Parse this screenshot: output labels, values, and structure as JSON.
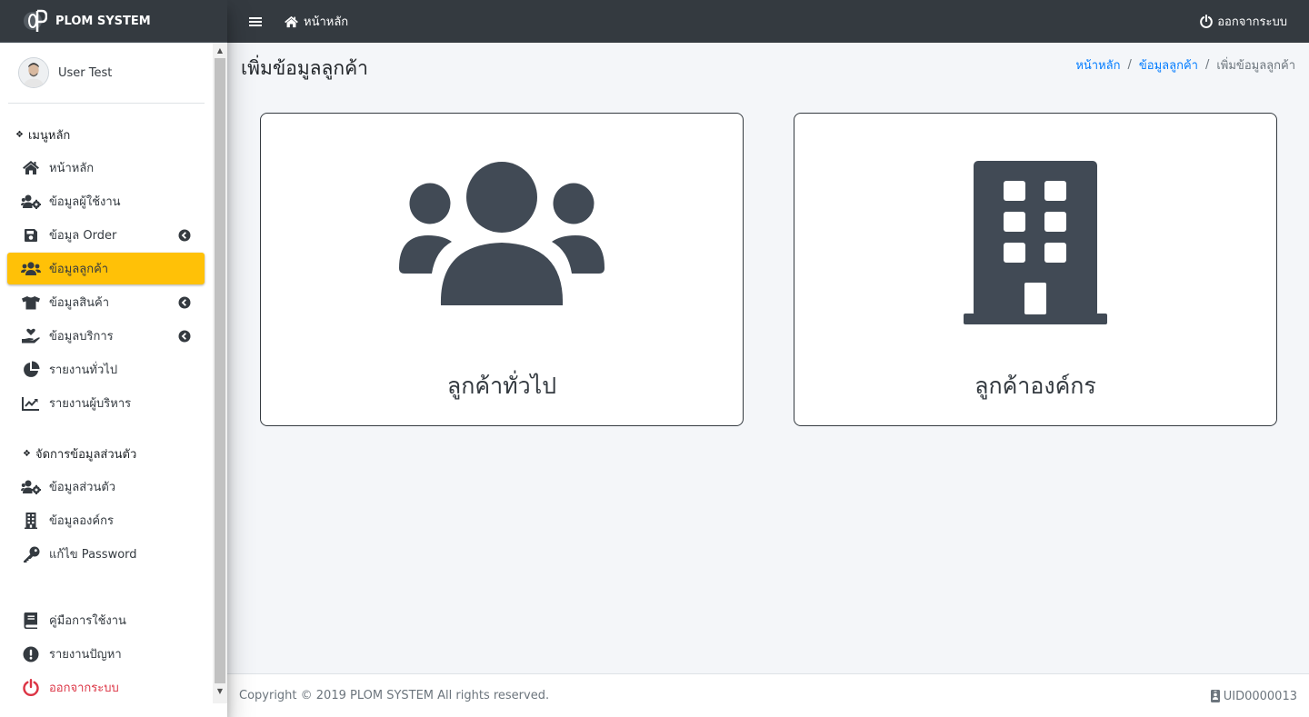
{
  "brand": {
    "name": "PLOM SYSTEM",
    "logo_letter": "P"
  },
  "user": {
    "name": "User Test"
  },
  "sidebar": {
    "sections": [
      {
        "header": "เมนูหลัก",
        "items": [
          {
            "label": "หน้าหลัก",
            "icon": "home-icon"
          },
          {
            "label": "ข้อมูลผู้ใช้งาน",
            "icon": "users-cog-icon"
          },
          {
            "label": "ข้อมูล Order",
            "icon": "save-icon",
            "has_submenu": true
          },
          {
            "label": "ข้อมูลลูกค้า",
            "icon": "users-icon",
            "active": true
          },
          {
            "label": "ข้อมูลสินค้า",
            "icon": "tshirt-icon",
            "has_submenu": true
          },
          {
            "label": "ข้อมูลบริการ",
            "icon": "hand-holding-heart-icon",
            "has_submenu": true
          },
          {
            "label": "รายงานทั่วไป",
            "icon": "chart-pie-icon"
          },
          {
            "label": "รายงานผู้บริหาร",
            "icon": "chart-line-icon"
          }
        ]
      },
      {
        "header": "จัดการข้อมูลส่วนตัว",
        "items": [
          {
            "label": "ข้อมูลส่วนตัว",
            "icon": "users-cog-icon"
          },
          {
            "label": "ข้อมูลองค์กร",
            "icon": "building-icon"
          },
          {
            "label": "แก้ไข Password",
            "icon": "key-icon"
          }
        ]
      }
    ],
    "bottom_items": [
      {
        "label": "คู่มือการใช้งาน",
        "icon": "book-icon"
      },
      {
        "label": "รายงานปัญหา",
        "icon": "exclamation-circle-icon"
      },
      {
        "label": "ออกจากระบบ",
        "icon": "power-off-icon"
      }
    ]
  },
  "topbar": {
    "home_label": "หน้าหลัก",
    "logout_label": "ออกจากระบบ"
  },
  "page": {
    "title": "เพิ่มข้อมูลลูกค้า",
    "breadcrumb": [
      "หน้าหลัก",
      "ข้อมูลลูกค้า",
      "เพิ่มข้อมูลลูกค้า"
    ]
  },
  "cards": [
    {
      "label": "ลูกค้าทั่วไป",
      "icon": "users-icon"
    },
    {
      "label": "ลูกค้าองค์กร",
      "icon": "building-icon"
    }
  ],
  "footer": {
    "copyright": "Copyright © 2019 PLOM SYSTEM All rights reserved.",
    "uid": "UID0000013"
  },
  "colors": {
    "navbar": "#343a40",
    "active_item": "#ffc107",
    "link": "#007bff",
    "logout": "#dc3545",
    "icon": "#414a55"
  }
}
